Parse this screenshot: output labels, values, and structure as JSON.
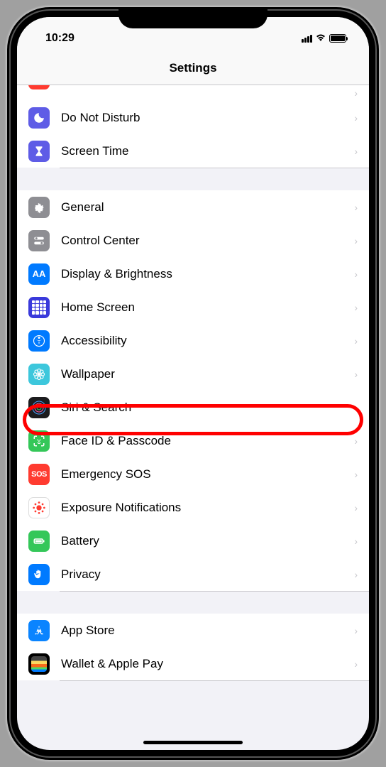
{
  "status": {
    "time": "10:29"
  },
  "header": {
    "title": "Settings"
  },
  "rows": {
    "dnd": "Do Not Disturb",
    "screen_time": "Screen Time",
    "general": "General",
    "control_center": "Control Center",
    "display": "Display & Brightness",
    "home_screen": "Home Screen",
    "accessibility": "Accessibility",
    "wallpaper": "Wallpaper",
    "siri": "Siri & Search",
    "face_id": "Face ID & Passcode",
    "sos": "Emergency SOS",
    "exposure": "Exposure Notifications",
    "battery": "Battery",
    "privacy": "Privacy",
    "app_store": "App Store",
    "wallet": "Wallet & Apple Pay"
  },
  "icon_labels": {
    "sos": "SOS",
    "display_aa": "AA"
  },
  "highlighted_row": "siri"
}
